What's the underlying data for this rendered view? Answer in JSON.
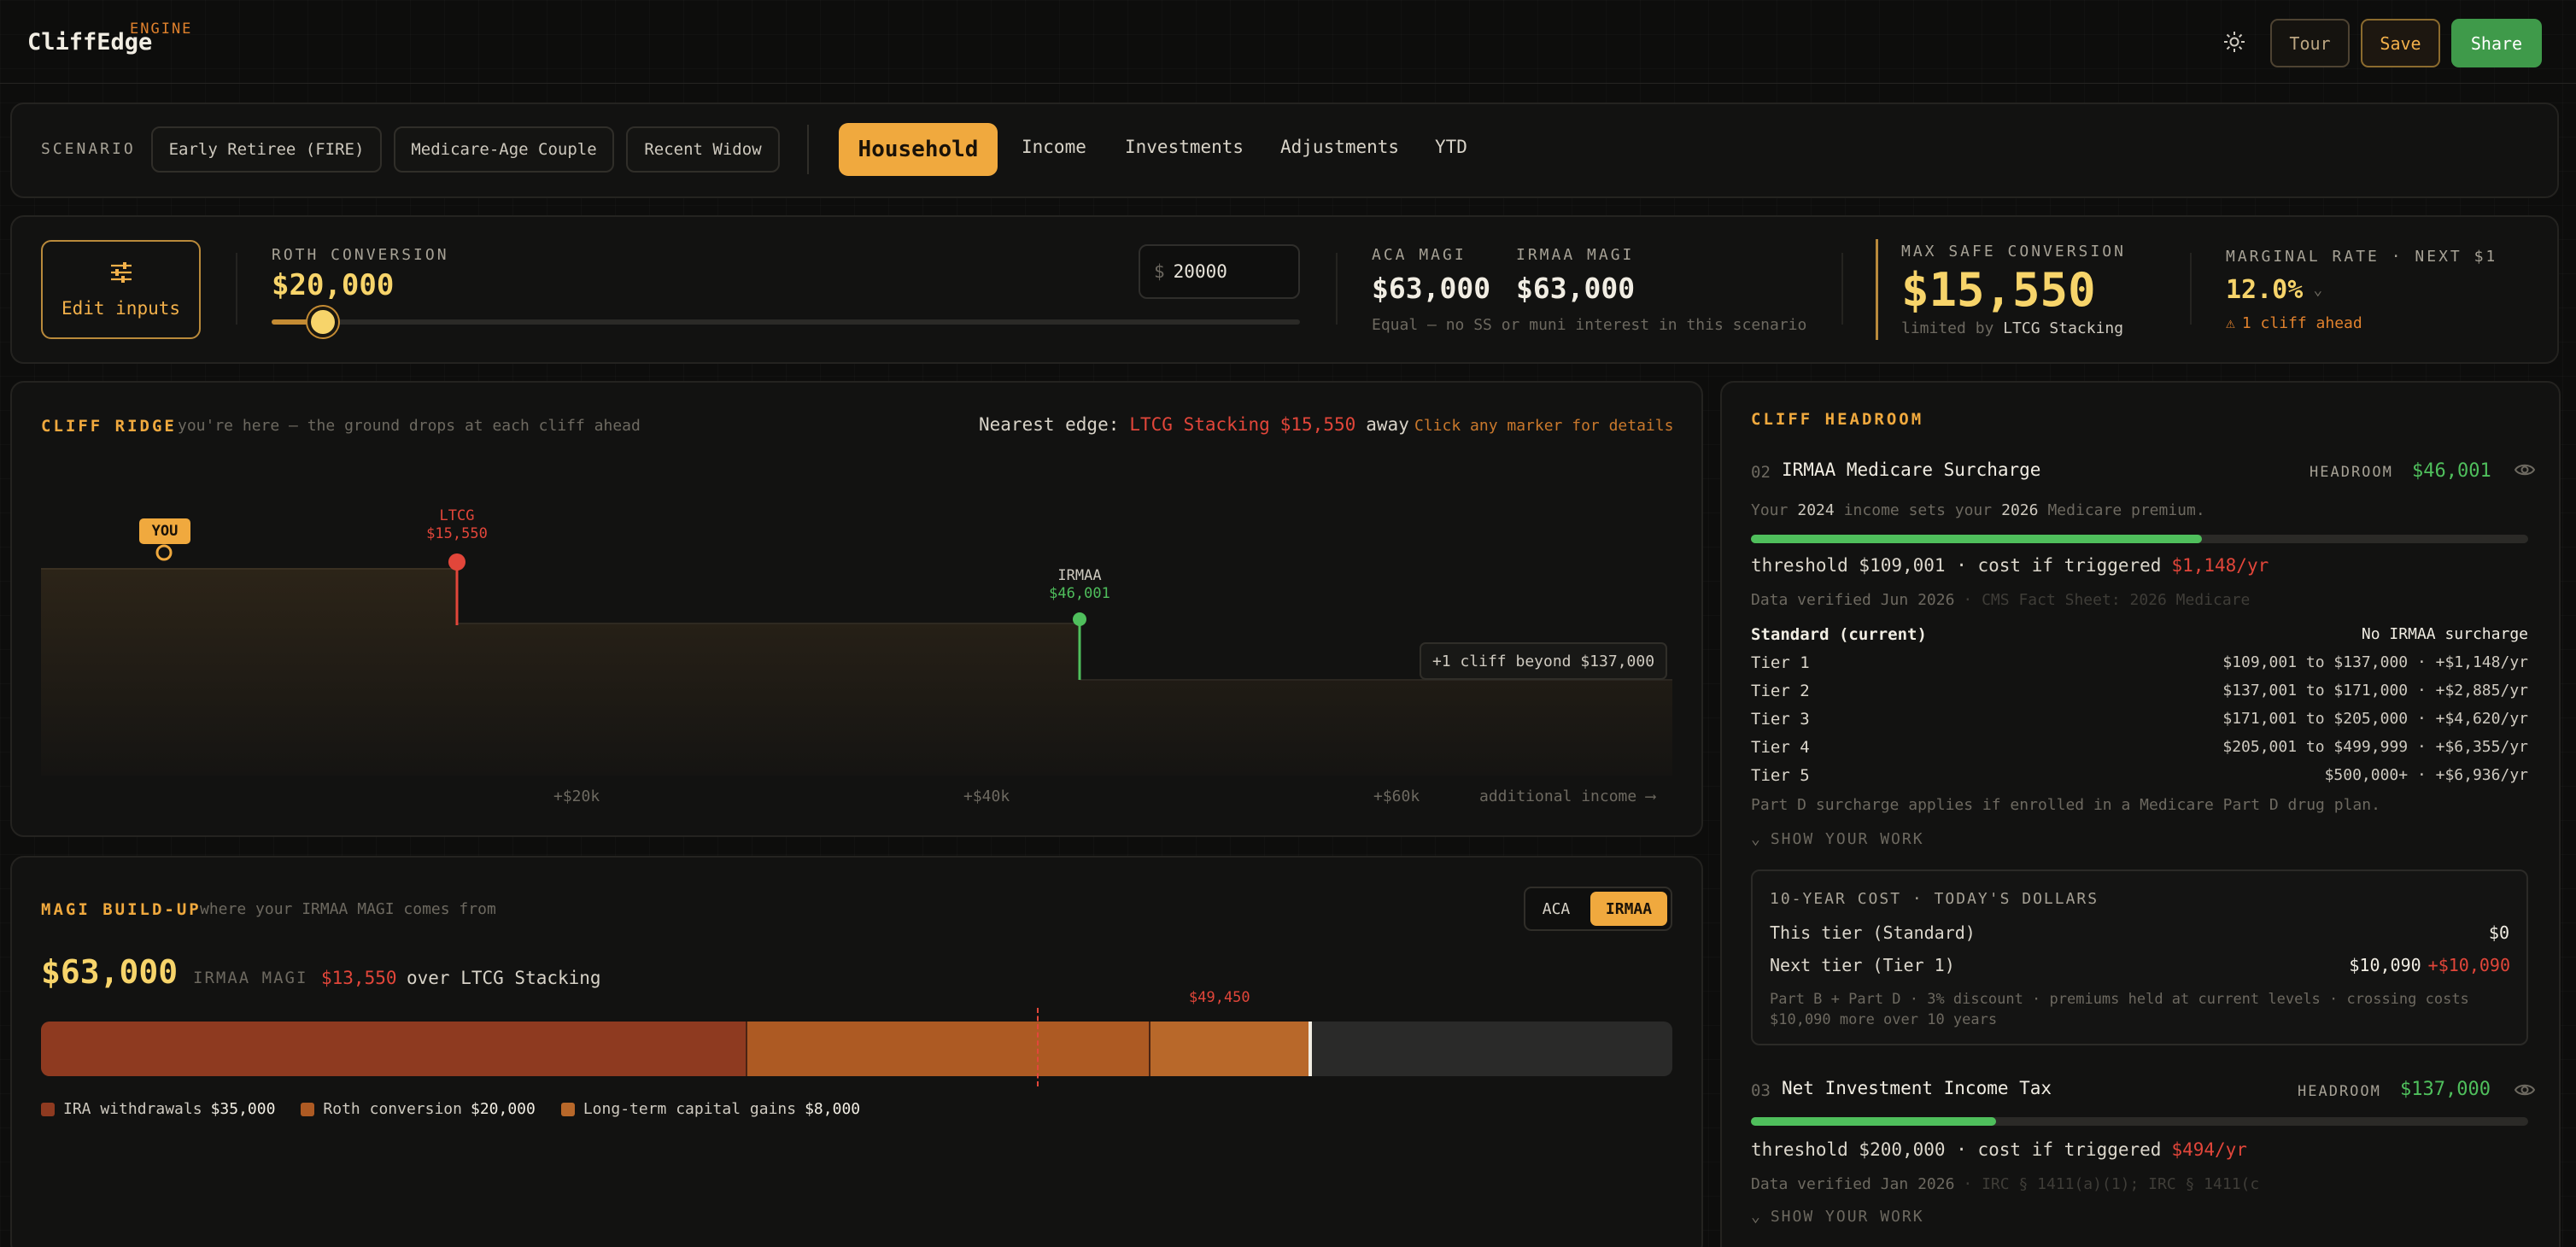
{
  "header": {
    "logo": "CliffEdge",
    "logo_sup": "ENGINE",
    "theme_icon": "sun-icon",
    "tour": "Tour",
    "save": "Save",
    "share": "Share"
  },
  "scenario": {
    "label": "SCENARIO",
    "chips": [
      "Early Retiree (FIRE)",
      "Medicare-Age Couple",
      "Recent Widow"
    ],
    "tabs": [
      "Household",
      "Income",
      "Investments",
      "Adjustments",
      "YTD"
    ],
    "active_tab": "Household"
  },
  "controls": {
    "edit_inputs": "Edit inputs",
    "edit_icon": "sliders-icon",
    "roth_label": "ROTH CONVERSION",
    "roth_value": "$20,000",
    "roth_input_currency": "$",
    "roth_input_value": "20000",
    "roth_slider_fraction": 0.05,
    "aca_label": "ACA MAGI",
    "aca_value": "$63,000",
    "irmaa_label": "IRMAA MAGI",
    "irmaa_value": "$63,000",
    "magi_note": "Equal — no SS or muni interest in this scenario",
    "max_safe_label": "MAX SAFE CONVERSION",
    "max_safe_value": "$15,550",
    "limited_by_prefix": "limited by",
    "limited_by": "LTCG Stacking",
    "marginal_label": "MARGINAL RATE · NEXT $1",
    "marginal_value": "12.0%",
    "cliff_ahead": "1 cliff ahead"
  },
  "ridge": {
    "title": "CLIFF RIDGE",
    "subtitle": "you're here — the ground drops at each cliff ahead",
    "nearest_prefix": "Nearest edge:",
    "nearest_name": "LTCG Stacking",
    "nearest_amount": "$15,550",
    "nearest_suffix": "away",
    "click_hint": "Click any marker for details",
    "you_label": "YOU",
    "ltcg_label": "LTCG",
    "ltcg_amount": "$15,550",
    "irmaa_label": "IRMAA",
    "irmaa_amount": "$46,001",
    "beyond": "+1 cliff beyond $137,000",
    "ticks": [
      "+$20k",
      "+$40k",
      "+$60k"
    ],
    "axis_label": "additional income ⟶"
  },
  "magi": {
    "title": "MAGI BUILD-UP",
    "subtitle": "where your IRMAA MAGI comes from",
    "toggle": [
      "ACA",
      "IRMAA"
    ],
    "active_toggle": "IRMAA",
    "total": "$63,000",
    "total_label": "IRMAA MAGI",
    "over_amount": "$13,550",
    "over_text": "over LTCG Stacking",
    "threshold_label": "$49,450",
    "scale_max": 81000,
    "threshold_value": 49450,
    "segments": [
      {
        "name": "IRA withdrawals",
        "amount": "$35,000",
        "value": 35000,
        "color": "#8e3a20"
      },
      {
        "name": "Roth conversion",
        "amount": "$20,000",
        "value": 20000,
        "color": "#ad5a23"
      },
      {
        "name": "Long-term capital gains",
        "amount": "$8,000",
        "value": 8000,
        "color": "#b8682a"
      }
    ]
  },
  "headroom": {
    "title": "CLIFF HEADROOM",
    "irmaa": {
      "num": "02",
      "name": "IRMAA Medicare Surcharge",
      "headroom_label": "HEADROOM",
      "headroom_value": "$46,001",
      "eye_icon": "eye-icon",
      "note_1": "Your",
      "note_year1": "2024",
      "note_2": "income sets your",
      "note_year2": "2026",
      "note_3": "Medicare premium.",
      "progress": 0.58,
      "threshold_text": "threshold $109,001 · cost if triggered",
      "cost": "$1,148/yr",
      "verified": "Data verified Jun 2026",
      "verified_src": "· CMS Fact Sheet: 2026 Medicare",
      "tiers": [
        {
          "name": "Standard (current)",
          "desc": "No IRMAA surcharge"
        },
        {
          "name": "Tier 1",
          "desc": "$109,001 to $137,000 · +$1,148/yr"
        },
        {
          "name": "Tier 2",
          "desc": "$137,001 to $171,000 · +$2,885/yr"
        },
        {
          "name": "Tier 3",
          "desc": "$171,001 to $205,000 · +$4,620/yr"
        },
        {
          "name": "Tier 4",
          "desc": "$205,001 to $499,999 · +$6,355/yr"
        },
        {
          "name": "Tier 5",
          "desc": "$500,000+ · +$6,936/yr"
        }
      ],
      "part_d_note": "Part D surcharge applies if enrolled in a Medicare Part D drug plan.",
      "show_work": "SHOW YOUR WORK",
      "work": {
        "title": "10-YEAR COST · TODAY'S DOLLARS",
        "this_tier": "This tier (Standard)",
        "this_tier_value": "$0",
        "next_tier": "Next tier (Tier 1)",
        "next_tier_value": "$10,090",
        "next_tier_delta": "+$10,090",
        "footnote_1": "Part B + Part D · 3% discount · premiums held at current levels · crossing costs",
        "footnote_2": "$10,090 more over 10 years"
      }
    },
    "niit": {
      "num": "03",
      "name": "Net Investment Income Tax",
      "headroom_label": "HEADROOM",
      "headroom_value": "$137,000",
      "progress": 0.315,
      "threshold_text": "threshold $200,000 · cost if triggered",
      "cost": "$494/yr",
      "verified": "Data verified Jan 2026",
      "verified_src": "· IRC § 1411(a)(1); IRC § 1411(c",
      "show_work": "SHOW YOUR WORK"
    }
  },
  "colors": {
    "accent": "#f0a93e",
    "gold": "#f7d46a",
    "red": "#e2463a",
    "green": "#4fbf5c"
  }
}
